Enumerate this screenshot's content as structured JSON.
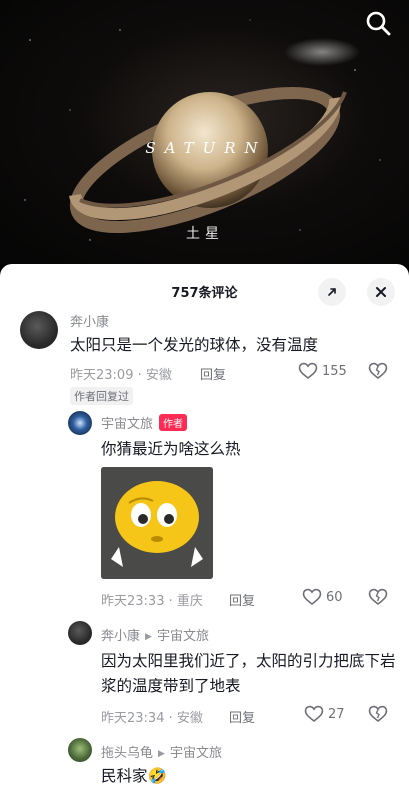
{
  "video": {
    "title_en": "SATURN",
    "title_cn": "土星"
  },
  "comments_panel": {
    "count_label": "757条评论"
  },
  "comments": [
    {
      "author": "奔小康",
      "text": "太阳只是一个发光的球体，没有温度",
      "time": "昨天23:09",
      "location": "安徽",
      "reply_label": "回复",
      "likes": "155",
      "author_liked": "作者回复过"
    },
    {
      "author": "宇宙文旅",
      "badge": "作者",
      "text": "你猜最近为啥这么热",
      "time": "昨天23:33",
      "location": "重庆",
      "reply_label": "回复",
      "likes": "60"
    },
    {
      "author": "奔小康",
      "reply_to": "宇宙文旅",
      "text": "因为太阳里我们近了，太阳的引力把底下岩浆的温度带到了地表",
      "time": "昨天23:34",
      "location": "安徽",
      "reply_label": "回复",
      "likes": "27"
    },
    {
      "author": "拖头乌龟",
      "reply_to": "宇宙文旅",
      "text": "民科家🤣"
    }
  ],
  "colors": {
    "accent": "#fe2c55",
    "secondary_text": "#9a9ba1",
    "primary_text": "#161823"
  },
  "icons": [
    "search-icon",
    "expand-icon",
    "close-icon",
    "heart-icon",
    "dislike-icon",
    "reply-arrow-icon"
  ]
}
